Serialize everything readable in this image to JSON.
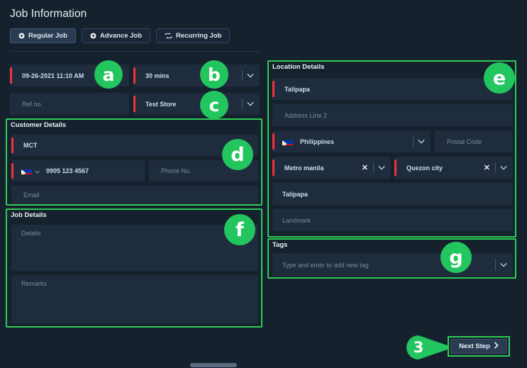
{
  "header": {
    "title": "Job Information",
    "tabs": [
      {
        "label": "Regular Job",
        "icon": "plus-circle-icon",
        "active": true
      },
      {
        "label": "Advance Job",
        "icon": "plus-circle-icon",
        "active": false
      },
      {
        "label": "Recurring Job",
        "icon": "repeat-icon",
        "active": false
      }
    ]
  },
  "schedule": {
    "datetime_value": "09-26-2021 11:10 AM",
    "duration_value": "30 mins",
    "refno_placeholder": "Ref no.",
    "store_value": "Test Store"
  },
  "customer": {
    "section_title": "Customer Details",
    "name_value": "MCT",
    "country_flag": "philippines-flag-icon",
    "phone_value": "0905 123 4567",
    "phone2_placeholder": "Phone No.",
    "email_placeholder": "Email"
  },
  "job": {
    "section_title": "Job Details",
    "details_placeholder": "Details",
    "remarks_placeholder": "Remarks"
  },
  "location": {
    "section_title": "Location Details",
    "address1_value": "Talipapa",
    "address2_placeholder": "Address Line 2",
    "country_value": "Philippines",
    "country_flag": "philippines-flag-icon",
    "postal_placeholder": "Postal Code",
    "province_value": "Metro manila",
    "city_value": "Quezon city",
    "barangay_value": "Talipapa",
    "landmark_placeholder": "Landmark"
  },
  "tags": {
    "section_title": "Tags",
    "placeholder": "Type and enter to add new tag"
  },
  "footer": {
    "next_label": "Next Step",
    "next_icon": "chevron-right-icon",
    "step_number": "3"
  },
  "markers": {
    "a": "a",
    "b": "b",
    "c": "c",
    "d": "d",
    "e": "e",
    "f": "f",
    "g": "g"
  },
  "colors": {
    "accent_green": "#2ecc55",
    "required_red": "#ef3340",
    "background": "#16212e",
    "field": "#1f2c3d"
  }
}
